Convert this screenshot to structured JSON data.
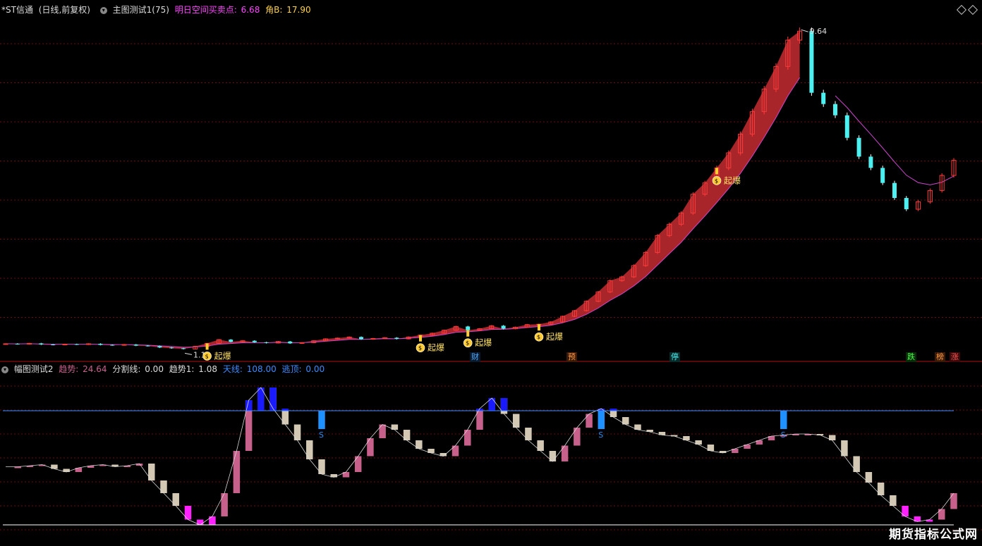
{
  "main_header": {
    "title": "*ST信通",
    "period": "(日线,前复权)",
    "indicator_name": "主图测试1(75)",
    "signal_label": "明日空间买卖点:",
    "signal_value": "6.68",
    "angle_label": "角B:",
    "angle_value": "17.90"
  },
  "sub_header": {
    "indicator_name": "幅图测试2",
    "trend_label": "趋势:",
    "trend_value": "24.64",
    "split_label": "分割线:",
    "split_value": "0.00",
    "trend1_label": "趋势1:",
    "trend1_value": "1.08",
    "sky_label": "天线:",
    "sky_value": "108.00",
    "escape_label": "逃顶:",
    "escape_value": "0.00"
  },
  "price_labels": {
    "high": "9.64",
    "low": "1.18"
  },
  "event_tags": [
    "财",
    "预",
    "停",
    "跌",
    "榜",
    "涨"
  ],
  "signal_text": "起爆",
  "sell_marker": "S",
  "watermark": "期货指标公式网",
  "colors": {
    "up": "#ff3b3b",
    "down": "#4df0f0",
    "band": "#a8262a",
    "bar_up": "#c8608c",
    "bar_down": "#d2c8b4",
    "peak": "#1a1aff",
    "sell": "#1e90ff",
    "bottom": "#ff22ff",
    "sky_line": "#3b8bff"
  },
  "chart_data": [
    {
      "type": "candlestick",
      "title": "*ST信通",
      "annotations": {
        "max": 9.64,
        "min": 1.18
      },
      "series": [
        {
          "name": "close",
          "values": [
            1.32,
            1.31,
            1.33,
            1.3,
            1.29,
            1.31,
            1.3,
            1.32,
            1.29,
            1.28,
            1.3,
            1.27,
            1.26,
            1.22,
            1.2,
            1.18,
            1.25,
            1.33,
            1.43,
            1.37,
            1.4,
            1.36,
            1.34,
            1.38,
            1.33,
            1.35,
            1.4,
            1.45,
            1.47,
            1.5,
            1.44,
            1.46,
            1.48,
            1.45,
            1.5,
            1.55,
            1.6,
            1.68,
            1.78,
            1.68,
            1.72,
            1.8,
            1.72,
            1.76,
            1.83,
            1.84,
            1.9,
            2.05,
            2.2,
            2.45,
            2.7,
            3.0,
            3.1,
            3.4,
            3.75,
            4.2,
            4.5,
            4.8,
            5.3,
            5.6,
            6.0,
            6.4,
            6.9,
            7.5,
            8.1,
            8.7,
            9.4,
            9.64,
            8.0,
            7.7,
            7.4,
            6.8,
            6.3,
            6.0,
            5.6,
            5.2,
            4.9,
            5.1,
            5.4,
            5.8,
            6.2
          ]
        }
      ]
    },
    {
      "type": "bar",
      "title": "幅图测试2",
      "ylim": [
        0,
        140
      ],
      "reference_lines": {
        "sky": 108,
        "split": 0
      },
      "sell_markers_at": [
        26,
        49,
        64
      ],
      "values": [
        55,
        55,
        56,
        57,
        53,
        50,
        54,
        56,
        57,
        55,
        56,
        58,
        42,
        30,
        18,
        5,
        0,
        8,
        30,
        70,
        118,
        130,
        110,
        95,
        80,
        62,
        48,
        45,
        50,
        65,
        82,
        95,
        90,
        80,
        72,
        68,
        65,
        75,
        90,
        110,
        120,
        105,
        92,
        80,
        70,
        60,
        75,
        92,
        105,
        110,
        102,
        95,
        90,
        88,
        85,
        84,
        80,
        76,
        70,
        68,
        72,
        76,
        80,
        84,
        85,
        86,
        86,
        85,
        80,
        65,
        50,
        40,
        28,
        18,
        8,
        3,
        5,
        15,
        30
      ]
    }
  ]
}
